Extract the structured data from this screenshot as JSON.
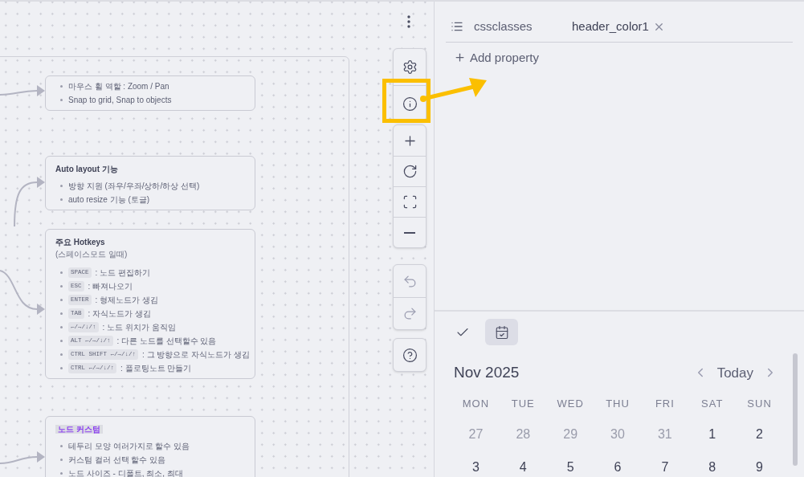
{
  "canvas": {
    "nodes": [
      {
        "items": [
          {
            "text": "마우스 휠 역할 : Zoom / Pan"
          },
          {
            "text": "Snap to grid, Snap to objects"
          }
        ]
      },
      {
        "title": "Auto layout 기능",
        "highlighted": false,
        "items": [
          {
            "text": "방향 지원 (좌우/우좌/상하/하상 선택)"
          },
          {
            "text": "auto resize 기능 (토글)"
          }
        ]
      },
      {
        "title": "주요 Hotkeys",
        "subtitle": "(스페이스모드 일때)",
        "highlighted": false,
        "items": [
          {
            "keys": "SPACE",
            "text": ": 노드 편집하기"
          },
          {
            "keys": "ESC",
            "text": ": 빠져나오기"
          },
          {
            "keys": "ENTER",
            "text": ": 형제노드가 생김"
          },
          {
            "keys": "TAB",
            "text": ": 자식노드가 생김"
          },
          {
            "keys": "←/→/↓/↑",
            "text": ": 노드 위치가 움직임"
          },
          {
            "keys": "ALT ←/→/↓/↑",
            "text": ": 다른 노드를 선택할수 있음"
          },
          {
            "keys": "CTRL SHIFT ←/→/↓/↑",
            "text": ": 그 방향으로 자식노드가 생김"
          },
          {
            "keys": "CTRL ←/→/↓/↑",
            "text": ": 플로팅노트 만들기"
          }
        ]
      },
      {
        "title": "노드 커스텀",
        "highlighted": true,
        "items": [
          {
            "text": "테두리 모양 여러가지로 할수 있음"
          },
          {
            "text": "커스텀 컬러 선택 할수 있음"
          },
          {
            "text": "노드 사이즈 - 디폴트, 최소, 최대"
          }
        ]
      }
    ],
    "toolbar": [
      [
        {
          "kind": "settings",
          "disabled": false
        },
        {
          "kind": "info",
          "disabled": false
        }
      ],
      [
        {
          "kind": "zoom-in",
          "disabled": false
        },
        {
          "kind": "reset",
          "disabled": false
        },
        {
          "kind": "fit",
          "disabled": false
        },
        {
          "kind": "zoom-out",
          "disabled": false
        }
      ],
      [
        {
          "kind": "undo",
          "disabled": true
        },
        {
          "kind": "redo",
          "disabled": true
        }
      ],
      [
        {
          "kind": "help",
          "disabled": false
        }
      ]
    ]
  },
  "properties": {
    "rows": [
      {
        "name": "cssclasses",
        "values": [
          "header_color1"
        ]
      }
    ],
    "add_label": "Add property"
  },
  "view_tabs": [
    {
      "kind": "tasks",
      "selected": false
    },
    {
      "kind": "calendar",
      "selected": true
    }
  ],
  "calendar": {
    "title": "Nov 2025",
    "today": "Today",
    "weekdays": [
      "MON",
      "TUE",
      "WED",
      "THU",
      "FRI",
      "SAT",
      "SUN"
    ],
    "weeks": [
      [
        {
          "day": "27",
          "muted": true
        },
        {
          "day": "28",
          "muted": true
        },
        {
          "day": "29",
          "muted": true
        },
        {
          "day": "30",
          "muted": true
        },
        {
          "day": "31",
          "muted": true
        },
        {
          "day": "1",
          "muted": false
        },
        {
          "day": "2",
          "muted": false
        }
      ],
      [
        {
          "day": "3",
          "muted": false
        },
        {
          "day": "4",
          "muted": false
        },
        {
          "day": "5",
          "muted": false
        },
        {
          "day": "6",
          "muted": false
        },
        {
          "day": "7",
          "muted": false
        },
        {
          "day": "8",
          "muted": false
        },
        {
          "day": "9",
          "muted": false
        }
      ]
    ]
  }
}
